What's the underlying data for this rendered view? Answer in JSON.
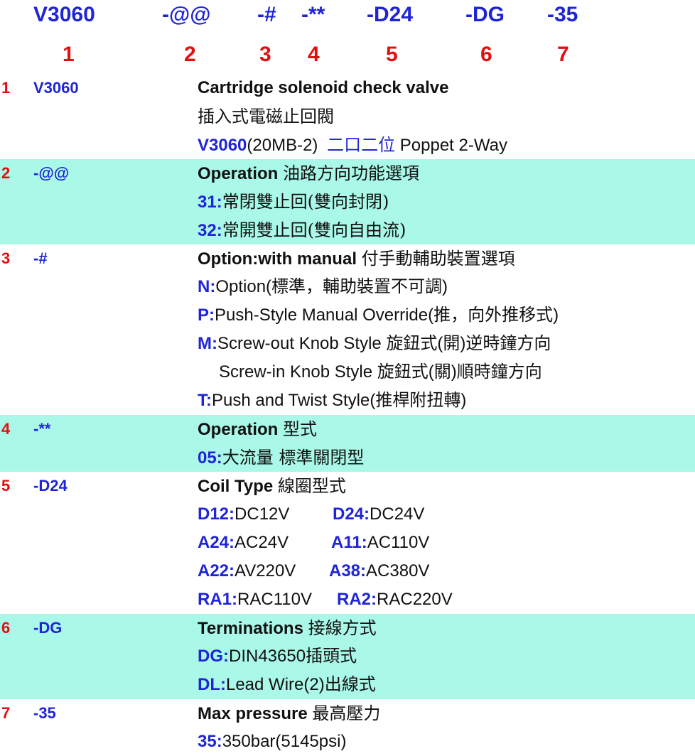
{
  "header": {
    "codes": [
      "V3060",
      "-@@",
      "-#",
      "-**",
      "-D24",
      "-DG",
      "-35"
    ],
    "indices": [
      "1",
      "2",
      "3",
      "4",
      "5",
      "6",
      "7"
    ]
  },
  "rows": [
    {
      "num": "1",
      "code": "V3060",
      "title": "Cartridge solenoid check valve",
      "line2": "插入式電磁止回閥",
      "line3_key": "V3060",
      "line3_a": "(20MB-2)",
      "line3_cjk": "二口二位",
      "line3_b": "Poppet 2-Way"
    },
    {
      "num": "2",
      "code": "-@@",
      "title": "Operation",
      "title_cjk": "油路方向功能選項",
      "items": [
        {
          "key": "31:",
          "text": "常閉雙止回(雙向封閉)"
        },
        {
          "key": "32:",
          "text": "常開雙止回(雙向自由流)"
        }
      ]
    },
    {
      "num": "3",
      "code": "-#",
      "title": "Option:with manual",
      "title_cjk": "付手動輔助裝置選項",
      "items": [
        {
          "key": "N:",
          "text": "Option(標準，輔助裝置不可調)"
        },
        {
          "key": "P:",
          "text": "Push-Style Manual Override(推，向外推移式)"
        },
        {
          "key": "M:",
          "text": "Screw-out Knob Style 旋鈕式(開)逆時鐘方向"
        },
        {
          "key": "",
          "text": "Screw-in Knob Style 旋鈕式(關)順時鐘方向"
        },
        {
          "key": "T:",
          "text": "Push and Twist Style(推桿附扭轉)"
        }
      ]
    },
    {
      "num": "4",
      "code": "-**",
      "title": "Operation",
      "title_cjk": "型式",
      "items": [
        {
          "key": "05:",
          "text": "大流量 標準關閉型"
        }
      ]
    },
    {
      "num": "5",
      "code": "-D24",
      "title": "Coil Type",
      "title_cjk": "線圈型式",
      "pairs": [
        {
          "k1": "D12:",
          "v1": "DC12V",
          "k2": "D24:",
          "v2": "DC24V"
        },
        {
          "k1": "A24:",
          "v1": "AC24V",
          "k2": "A11:",
          "v2": "AC110V"
        },
        {
          "k1": "A22:",
          "v1": "AV220V",
          "k2": "A38:",
          "v2": "AC380V"
        },
        {
          "k1": "RA1:",
          "v1": "RAC110V",
          "k2": "RA2:",
          "v2": "RAC220V"
        }
      ]
    },
    {
      "num": "6",
      "code": "-DG",
      "title": "Terminations",
      "title_cjk": "接線方式",
      "items": [
        {
          "key": "DG:",
          "text": "DIN43650插頭式"
        },
        {
          "key": "DL:",
          "text": "Lead Wire(2)出線式"
        }
      ]
    },
    {
      "num": "7",
      "code": "-35",
      "title": "Max pressure",
      "title_cjk": "最高壓力",
      "items": [
        {
          "key": "35:",
          "text": "350bar(5145psi)"
        }
      ]
    }
  ],
  "colors": {
    "blue": "#1f25d6",
    "red": "#e01010",
    "band": "#aaf8e8",
    "text": "#111111"
  }
}
